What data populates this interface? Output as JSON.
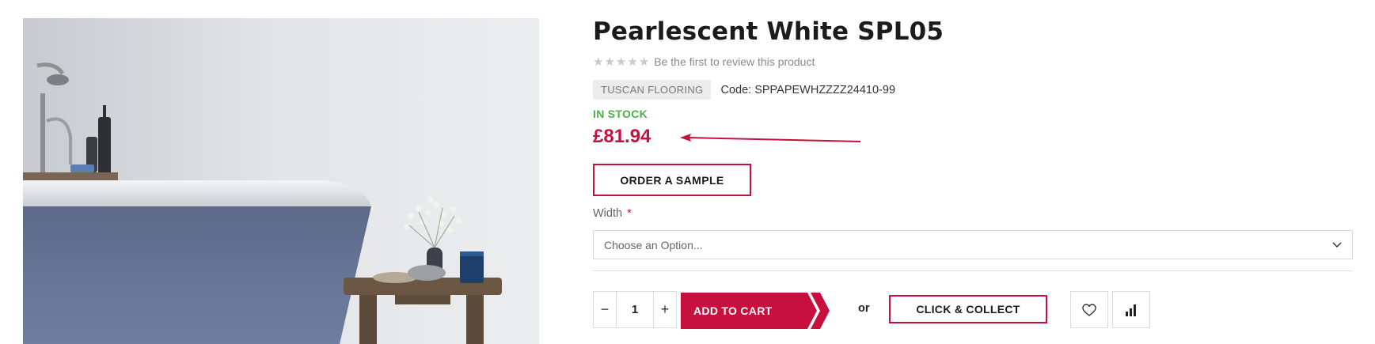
{
  "product": {
    "title": "Pearlescent White SPL05",
    "review_text": "Be the first to review this product",
    "stars": [
      "★",
      "★",
      "★",
      "★",
      "★"
    ],
    "brand": "TUSCAN FLOORING",
    "code_label": "Code:",
    "code_value": "SPPAPEWHZZZZ24410-99",
    "stock_status": "IN STOCK",
    "price": "£81.94"
  },
  "actions": {
    "order_sample_label": "ORDER A SAMPLE",
    "width_label": "Width",
    "required_mark": "*",
    "width_placeholder": "Choose an Option...",
    "qty_minus": "−",
    "qty_value": "1",
    "qty_plus": "+",
    "add_to_cart_label": "ADD TO CART",
    "or_label": "or",
    "click_collect_label": "CLICK & COLLECT"
  },
  "icons": {
    "wishlist": "heart-icon",
    "compare": "bar-chart-icon",
    "select_chevron": "chevron-down-icon"
  },
  "colors": {
    "accent": "#c8103e",
    "in_stock": "#4caf50",
    "badge_bg": "#ececec"
  }
}
